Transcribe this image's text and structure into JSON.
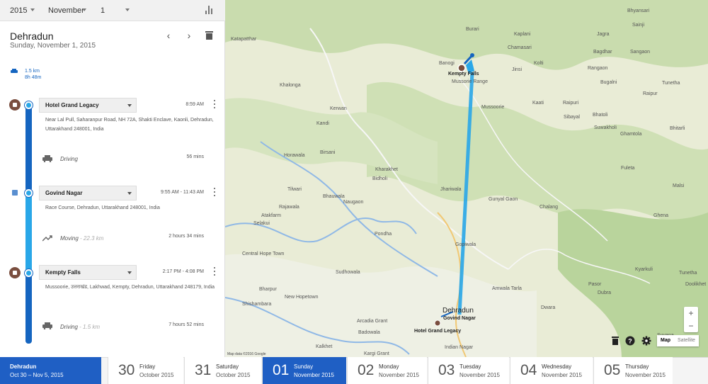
{
  "filters": {
    "year": "2015",
    "month": "November",
    "day": "1"
  },
  "header": {
    "title": "Dehradun",
    "subtitle": "Sunday, November 1, 2015"
  },
  "summary": {
    "distance": "1.5 km",
    "duration": "8h 48m"
  },
  "places": [
    {
      "name": "Hotel Grand Legacy",
      "time": "8:59 AM",
      "address": "Near Lal Pull, Saharanpur Road, NH 72A, Shakti Enclave, Kaonli, Dehradun, Uttarakhand 248001, India"
    },
    {
      "name": "Govind Nagar",
      "time": "9:55 AM - 11:43 AM",
      "address": "Race Course, Dehradun, Uttarakhand 248001, India"
    },
    {
      "name": "Kempty Falls",
      "time": "2:17 PM - 4:08 PM",
      "address": "Mussoorie, उत्तराखंड, Lakhwad, Kempty, Dehradun, Uttarakhand 248179, India"
    }
  ],
  "activities": [
    {
      "label": "Driving",
      "extra": "",
      "duration": "56 mins",
      "icon": "car-icon"
    },
    {
      "label": "Moving",
      "extra": " - 22.3 km",
      "duration": "2 hours 34 mins",
      "icon": "trend-icon"
    },
    {
      "label": "Driving",
      "extra": " - 1.5 km",
      "duration": "7 hours 52 mins",
      "icon": "car-icon"
    }
  ],
  "map": {
    "labels": [
      "Bhyansari",
      "Sainji",
      "Burari",
      "Kaplani",
      "Jagra",
      "Chamasari",
      "Bagdhar",
      "Sangaon",
      "Katapatthar",
      "Banogi",
      "Kempty Falls",
      "Jinsi",
      "Kolti",
      "Rangaon",
      "Mussorie Range",
      "Bugalni",
      "Tunetha",
      "Khalonga",
      "Raipur",
      "Kaati",
      "Raipuri",
      "Kerwan",
      "Mussoorie",
      "Bhatoli",
      "Kandi",
      "Sibayal",
      "Bhitarli",
      "Suwakholi",
      "Horawala",
      "Ghamtola",
      "Birsani",
      "Fuleta",
      "Kharakhet",
      "Bidholi",
      "Malsi",
      "Tilwari",
      "Bhauwala",
      "Jhariwala",
      "Rajawala",
      "Naugaon",
      "Gunyal Gaon",
      "Chalang",
      "Atakfarm",
      "Selakui",
      "Ghena",
      "Pondha",
      "Central Hope Town",
      "Gopiwala",
      "Sudhowala",
      "Kyarkuli",
      "Bharpur",
      "Doolikhet",
      "Tunetha",
      "Shishambara",
      "New Hopetown",
      "Amwala Tarla",
      "Dubra",
      "Pasor",
      "Dwara",
      "Arcadia Grant",
      "Badowala",
      "Kargi Grant",
      "Kalkhet",
      "Indian Nagar",
      "Suvana"
    ],
    "city_label": "Dehradun",
    "pin_top": "Kempty Falls",
    "pin_bottom_a": "Govind Nagar",
    "pin_bottom_b": "Hotel Grand Legacy",
    "attribution": "Map data ©2016 Google",
    "map_type": [
      "Map",
      "Satellite"
    ],
    "zoom_in": "+",
    "zoom_out": "−"
  },
  "date_range": {
    "place": "Dehradun",
    "range": "Oct 30 – Nov 5, 2015"
  },
  "days": [
    {
      "num": "30",
      "name": "Friday",
      "month": "October 2015"
    },
    {
      "num": "31",
      "name": "Saturday",
      "month": "October 2015"
    },
    {
      "num": "01",
      "name": "Sunday",
      "month": "November 2015"
    },
    {
      "num": "02",
      "name": "Monday",
      "month": "November 2015"
    },
    {
      "num": "03",
      "name": "Tuesday",
      "month": "November 2015"
    },
    {
      "num": "04",
      "name": "Wednesday",
      "month": "November 2015"
    },
    {
      "num": "05",
      "name": "Thursday",
      "month": "November 2015"
    }
  ],
  "colors": {
    "accent": "#1f5fc4",
    "route": "#29a7e8",
    "timeline_dark": "#1565c0"
  }
}
